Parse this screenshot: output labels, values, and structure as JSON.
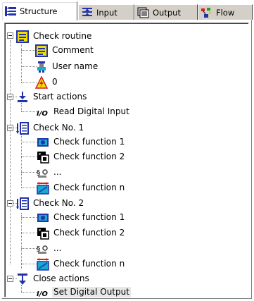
{
  "tabs": [
    {
      "label": "Structure",
      "icon": "structure-icon",
      "active": true
    },
    {
      "label": "Input",
      "icon": "input-icon",
      "active": false
    },
    {
      "label": "Output",
      "icon": "output-icon",
      "active": false
    },
    {
      "label": "Flow",
      "icon": "flow-icon",
      "active": false
    }
  ],
  "tree": {
    "check_routine": "Check routine",
    "comment": "Comment",
    "user_name": "User name",
    "zero": "0",
    "start_actions": "Start actions",
    "read_digital_input": "Read Digital Input",
    "check1": "Check No. 1",
    "check1_fn1": "Check function 1",
    "check1_fn2": "Check function 2",
    "check1_ellipsis": "...",
    "check1_fnn": "Check function n",
    "check2": "Check No. 2",
    "check2_fn1": "Check function 1",
    "check2_fn2": "Check function 2",
    "check2_ellipsis": "...",
    "check2_fnn": "Check function n",
    "close_actions": "Close actions",
    "set_digital_output": "Set Digital Output"
  },
  "colors": {
    "tab_face": "#d4d0c8",
    "icon_blue": "#2233aa",
    "icon_yellow": "#f0e000",
    "icon_cyan": "#18a8d0",
    "icon_red": "#d02020",
    "selection": "#e8e8e8"
  }
}
